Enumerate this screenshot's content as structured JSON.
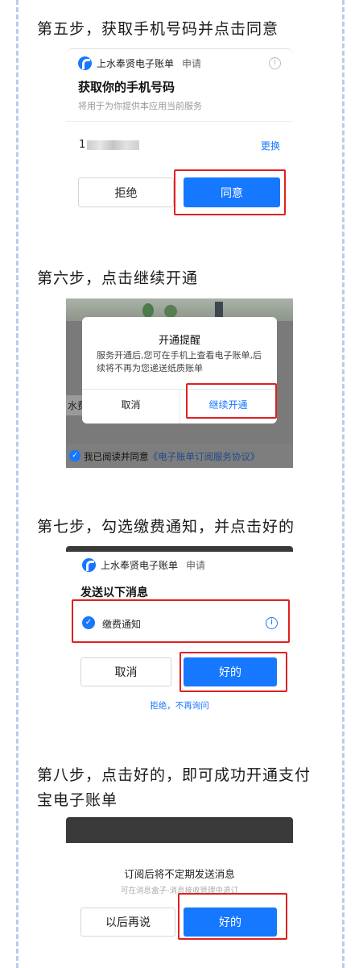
{
  "step5": {
    "title": "第五步，获取手机号码并点击同意",
    "app_name": "上水奉贤电子账单",
    "apply": "申请",
    "heading": "获取你的手机号码",
    "subtitle": "将用于为你提供本应用当前服务",
    "phone_prefix": "1",
    "change": "更换",
    "reject": "拒绝",
    "agree": "同意"
  },
  "step6": {
    "title": "第六步，点击继续开通",
    "dialog_title": "开通提醒",
    "dialog_body": "服务开通后,您可在手机上查看电子账单,后续将不再为您递送纸质账单",
    "cancel": "取消",
    "continue": "继续开通",
    "bg_text": "水费",
    "agree_prefix": "我已阅读并同意",
    "agreement_link": "《电子账单订阅服务协议》"
  },
  "step7": {
    "title": "第七步，勾选缴费通知，并点击好的",
    "app_name": "上水奉贤电子账单",
    "apply": "申请",
    "heading": "发送以下消息",
    "item": "缴费通知",
    "cancel": "取消",
    "ok": "好的",
    "reject": "拒绝，不再询问"
  },
  "step8": {
    "title_line1": "第八步，点击好的，即可成功开通支付",
    "title_line2": "宝电子账单",
    "message": "订阅后将不定期发送消息",
    "hint": "可在消息盒子-消息接收管理中退订",
    "later": "以后再说",
    "ok": "好的"
  },
  "colors": {
    "accent": "#1677ff",
    "highlight": "#e02020",
    "dash": "#b8cdea"
  }
}
